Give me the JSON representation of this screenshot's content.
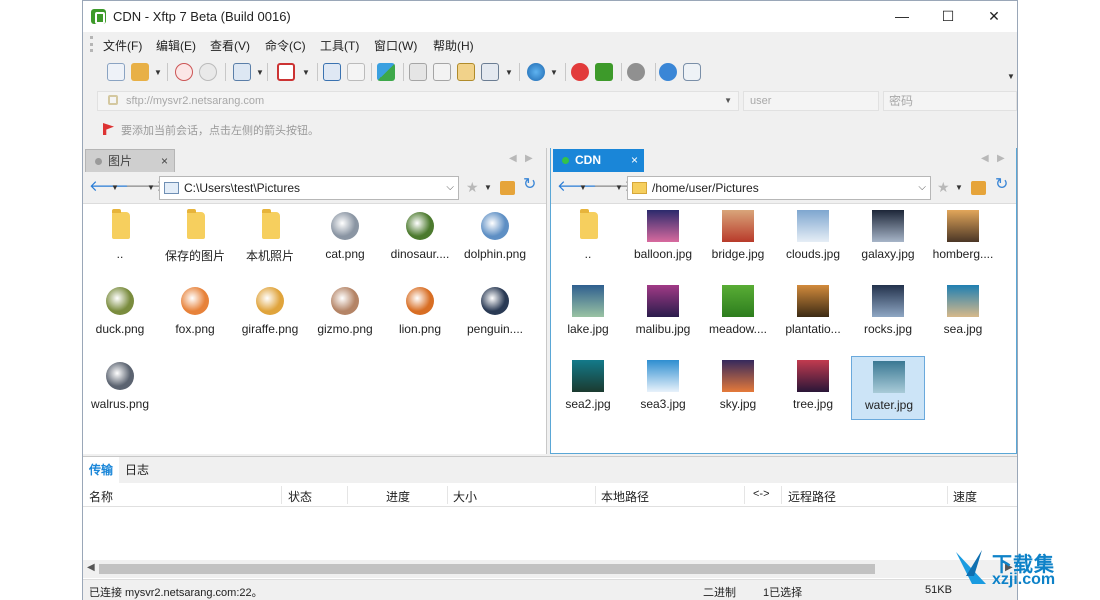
{
  "window": {
    "title": "CDN - Xftp 7 Beta (Build 0016)",
    "minimize": "—",
    "maximize": "☐",
    "close": "✕"
  },
  "menu": [
    "文件(F)",
    "编辑(E)",
    "查看(V)",
    "命令(C)",
    "工具(T)",
    "窗口(W)",
    "帮助(H)"
  ],
  "address": {
    "placeholder": "sftp://mysvr2.netsarang.com",
    "user_placeholder": "user",
    "password_placeholder": "密码"
  },
  "hint": "要添加当前会话，点击左侧的箭头按钮。",
  "left_pane": {
    "tab": "图片",
    "path": "C:\\Users\\test\\Pictures",
    "files": [
      {
        "name": "..",
        "type": "folder"
      },
      {
        "name": "保存的图片",
        "type": "folder"
      },
      {
        "name": "本机照片",
        "type": "folder"
      },
      {
        "name": "cat.png",
        "type": "image",
        "color": "#8a95a3"
      },
      {
        "name": "dinosaur....",
        "type": "image",
        "color": "#4c7a2e"
      },
      {
        "name": "dolphin.png",
        "type": "image",
        "color": "#5e8fc4"
      },
      {
        "name": "duck.png",
        "type": "image",
        "color": "#7a8c3e"
      },
      {
        "name": "fox.png",
        "type": "image",
        "color": "#e7823a"
      },
      {
        "name": "giraffe.png",
        "type": "image",
        "color": "#e0a43c"
      },
      {
        "name": "gizmo.png",
        "type": "image",
        "color": "#b48466"
      },
      {
        "name": "lion.png",
        "type": "image",
        "color": "#d86e24"
      },
      {
        "name": "penguin....",
        "type": "image",
        "color": "#2a3a54"
      },
      {
        "name": "walrus.png",
        "type": "image",
        "color": "#5b6370"
      }
    ]
  },
  "right_pane": {
    "tab": "CDN",
    "path": "/home/user/Pictures",
    "files": [
      {
        "name": "..",
        "type": "folder"
      },
      {
        "name": "balloon.jpg",
        "type": "photo",
        "colors": [
          "#2b2a6c",
          "#d86a9e"
        ]
      },
      {
        "name": "bridge.jpg",
        "type": "photo",
        "colors": [
          "#d9a57a",
          "#b83a2a"
        ]
      },
      {
        "name": "clouds.jpg",
        "type": "photo",
        "colors": [
          "#7ea6cf",
          "#e6eef6"
        ]
      },
      {
        "name": "galaxy.jpg",
        "type": "photo",
        "colors": [
          "#1d2638",
          "#a7b5c8"
        ]
      },
      {
        "name": "homberg....",
        "type": "photo",
        "colors": [
          "#e2a65a",
          "#4b3626"
        ]
      },
      {
        "name": "lake.jpg",
        "type": "photo",
        "colors": [
          "#2f5f8f",
          "#9ac3a3"
        ]
      },
      {
        "name": "malibu.jpg",
        "type": "photo",
        "colors": [
          "#a13a86",
          "#2a1c4c"
        ]
      },
      {
        "name": "meadow....",
        "type": "photo",
        "colors": [
          "#59ad35",
          "#2d7d1e"
        ]
      },
      {
        "name": "plantatio...",
        "type": "photo",
        "colors": [
          "#d28a3c",
          "#3c2a14"
        ]
      },
      {
        "name": "rocks.jpg",
        "type": "photo",
        "colors": [
          "#23324c",
          "#8fa7c4"
        ]
      },
      {
        "name": "sea.jpg",
        "type": "photo",
        "colors": [
          "#1f7fb2",
          "#d7b98a"
        ]
      },
      {
        "name": "sea2.jpg",
        "type": "photo",
        "colors": [
          "#137a8a",
          "#1b3a2f"
        ]
      },
      {
        "name": "sea3.jpg",
        "type": "photo",
        "colors": [
          "#2e8ed0",
          "#e8f2fb"
        ]
      },
      {
        "name": "sky.jpg",
        "type": "photo",
        "colors": [
          "#35295d",
          "#e57a3a"
        ]
      },
      {
        "name": "tree.jpg",
        "type": "photo",
        "colors": [
          "#c23b4f",
          "#2a1638"
        ]
      },
      {
        "name": "water.jpg",
        "type": "photo",
        "colors": [
          "#3a7893",
          "#a9cbd8"
        ],
        "selected": true
      }
    ]
  },
  "transfer": {
    "tabs": [
      "传输",
      "日志"
    ],
    "columns": [
      "名称",
      "状态",
      "进度",
      "大小",
      "本地路径",
      "<->",
      "远程路径",
      "速度"
    ]
  },
  "status": {
    "connection": "已连接 mysvr2.netsarang.com:22。",
    "mode": "二进制",
    "selection": "1已选择",
    "size": "51KB"
  },
  "watermark": {
    "text_cn": "下载集",
    "url": "xzji.com"
  }
}
